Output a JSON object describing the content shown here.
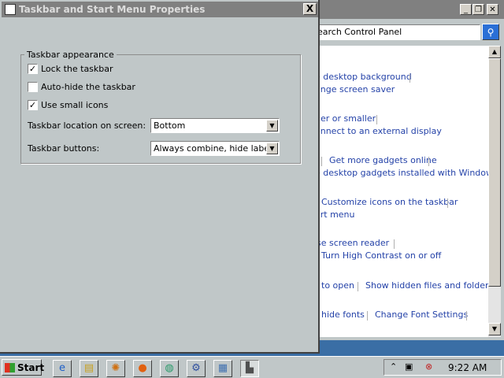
{
  "colors": {
    "desktop": "#3a6ea5",
    "face": "#c0c7c8",
    "link": "#2442a8",
    "inactive_title": "#808080"
  },
  "control_panel": {
    "search_placeholder": "earch Control Panel",
    "buttons": {
      "minimize": "_",
      "maximize": "❐",
      "close": "✕"
    },
    "links": [
      {
        "text": "e desktop background"
      },
      {
        "text": "ange screen saver"
      },
      {
        "text": "ger or smaller"
      },
      {
        "text": "onnect to an external display"
      },
      {
        "text": "Get more gadgets online"
      },
      {
        "text": "e desktop gadgets installed with Windows"
      },
      {
        "text": "Customize icons on the taskbar"
      },
      {
        "text": "art menu"
      },
      {
        "text": "se screen reader"
      },
      {
        "text": "Turn High Contrast on or off"
      },
      {
        "text": "to open"
      },
      {
        "text": "Show hidden files and folders"
      },
      {
        "text": "hide fonts"
      },
      {
        "text": "Change Font Settings"
      }
    ]
  },
  "dialog": {
    "title": "Taskbar and Start Menu Properties",
    "close_label": "X",
    "group_label": "Taskbar appearance",
    "checkboxes": [
      {
        "label": "Lock the taskbar",
        "checked": true,
        "mark": "✓"
      },
      {
        "label": "Auto-hide the taskbar",
        "checked": false,
        "mark": ""
      },
      {
        "label": "Use small icons",
        "checked": true,
        "mark": "✓"
      }
    ],
    "location_label": "Taskbar location on screen:",
    "location_value": "Bottom",
    "buttons_label": "Taskbar buttons:",
    "buttons_value": "Always combine, hide labels"
  },
  "taskbar": {
    "start_label": "Start",
    "quick_launch": [
      {
        "icon": "internet-explorer-icon",
        "glyph": "e",
        "color": "#1e5fc8"
      },
      {
        "icon": "file-explorer-icon",
        "glyph": "▤",
        "color": "#c8a020"
      },
      {
        "icon": "media-icon",
        "glyph": "✺",
        "color": "#d07010"
      },
      {
        "icon": "firefox-icon",
        "glyph": "●",
        "color": "#e06010"
      },
      {
        "icon": "network-icon",
        "glyph": "◍",
        "color": "#2a9a6a"
      },
      {
        "icon": "settings-icon",
        "glyph": "⚙",
        "color": "#3050a0"
      },
      {
        "icon": "display-icon",
        "glyph": "▦",
        "color": "#4070b0"
      },
      {
        "icon": "taskbar-properties-icon",
        "glyph": "▙",
        "color": "#505050"
      }
    ],
    "tray_icons": [
      "chevron-up-icon",
      "network-tray-icon",
      "volume-muted-icon"
    ],
    "clock": "9:22 AM"
  }
}
